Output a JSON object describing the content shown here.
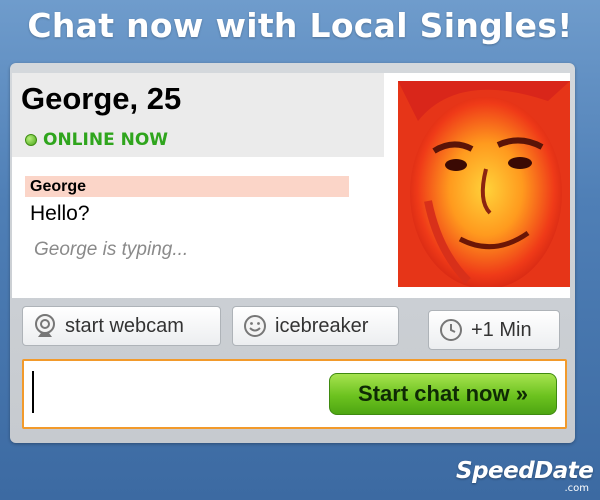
{
  "headline": "Chat now with Local Singles!",
  "profile": {
    "name": "George, 25",
    "status": "ONLINE NOW"
  },
  "chat": {
    "sender": "George",
    "message": "Hello?",
    "typing": "George is typing..."
  },
  "buttons": {
    "webcam": "start webcam",
    "icebreaker": "icebreaker",
    "minute": "+1 Min",
    "start_chat": "Start chat now »"
  },
  "input": {
    "value": "",
    "placeholder": ""
  },
  "brand": {
    "name": "SpeedDate",
    "domain": ".com"
  },
  "colors": {
    "status_green": "#2fa51d",
    "sender_highlight": "#fbd5c8",
    "input_border": "#f29a2b",
    "start_button": "#6cc21f"
  },
  "icons": [
    "webcam-icon",
    "smiley-icon",
    "clock-icon",
    "status-dot-icon"
  ]
}
